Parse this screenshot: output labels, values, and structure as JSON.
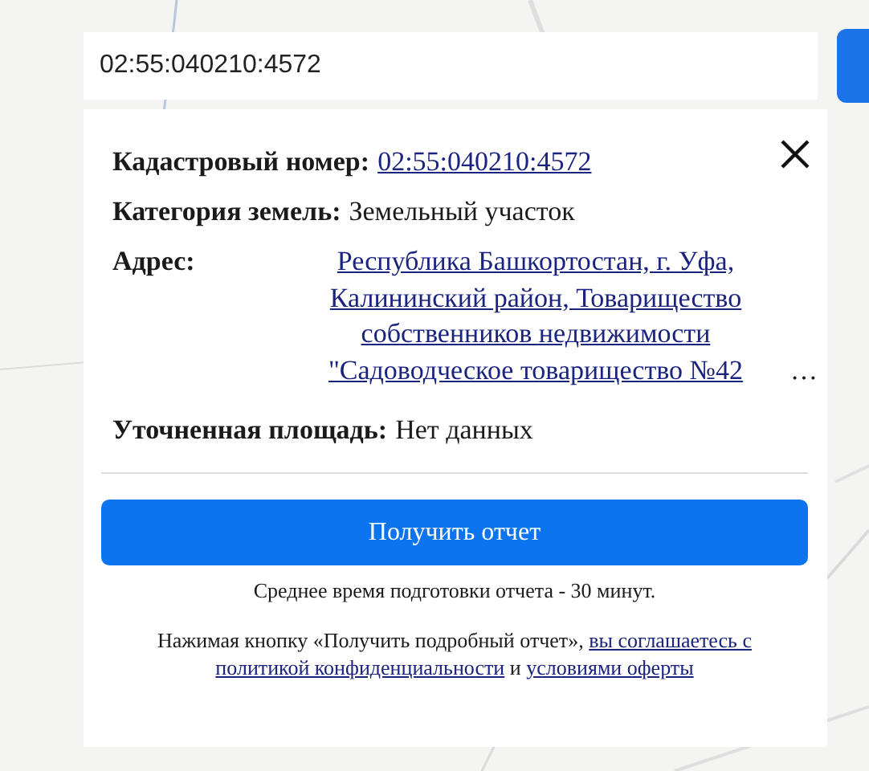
{
  "search": {
    "value": "02:55:040210:4572"
  },
  "card": {
    "fields": [
      {
        "kind": "link",
        "label": "Кадастровый номер:",
        "value": "02:55:040210:4572"
      },
      {
        "kind": "text",
        "label": "Категория земель:",
        "value": "Земельный участок"
      },
      {
        "kind": "address",
        "label": "Адрес:",
        "value": "Республика Башкортостан, г. Уфа, Калининский район, Товарищество собственников недвижимости \"Садоводческое товарищество №42 ",
        "ellipsis": "…"
      },
      {
        "kind": "text",
        "label": "Уточненная площадь:",
        "value": "Нет данных"
      }
    ],
    "report_button": "Получить отчет",
    "note": "Среднее время подготовки отчета - 30 минут.",
    "disclaimer": [
      {
        "kind": "text",
        "text": "Нажимая кнопку «Получить подробный отчет», "
      },
      {
        "kind": "link",
        "text": "вы соглашаетесь с"
      },
      {
        "kind": "link",
        "text": "политикой конфиденциальности"
      },
      {
        "kind": "text",
        "text": " и "
      },
      {
        "kind": "link",
        "text": "условиями оферты"
      }
    ]
  }
}
